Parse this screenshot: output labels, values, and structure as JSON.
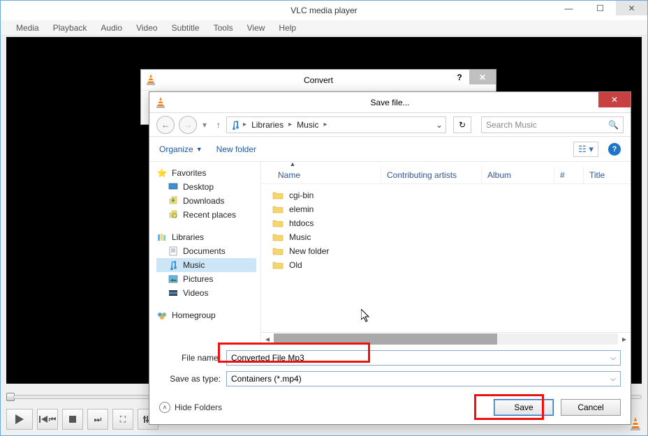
{
  "vlc": {
    "title": "VLC media player",
    "menu": [
      "Media",
      "Playback",
      "Audio",
      "Video",
      "Subtitle",
      "Tools",
      "View",
      "Help"
    ]
  },
  "convert_dialog": {
    "title": "Convert"
  },
  "save_dialog": {
    "title": "Save file...",
    "breadcrumb": {
      "lib": "Libraries",
      "music": "Music"
    },
    "search_placeholder": "Search Music",
    "organize": "Organize",
    "new_folder": "New folder",
    "columns": {
      "name": "Name",
      "contrib": "Contributing artists",
      "album": "Album",
      "num": "#",
      "title": "Title"
    },
    "sidebar": {
      "favorites": {
        "label": "Favorites",
        "items": [
          "Desktop",
          "Downloads",
          "Recent places"
        ]
      },
      "libraries": {
        "label": "Libraries",
        "items": [
          "Documents",
          "Music",
          "Pictures",
          "Videos"
        ]
      },
      "homegroup": {
        "label": "Homegroup"
      }
    },
    "files": [
      "cgi-bin",
      "elemin",
      "htdocs",
      "Music",
      "New folder",
      "Old"
    ],
    "file_name_label": "File name:",
    "file_name_value": "Converted File Mp3",
    "save_type_label": "Save as type:",
    "save_type_value": "Containers (*.mp4)",
    "hide_folders": "Hide Folders",
    "save_btn": "Save",
    "cancel_btn": "Cancel"
  }
}
